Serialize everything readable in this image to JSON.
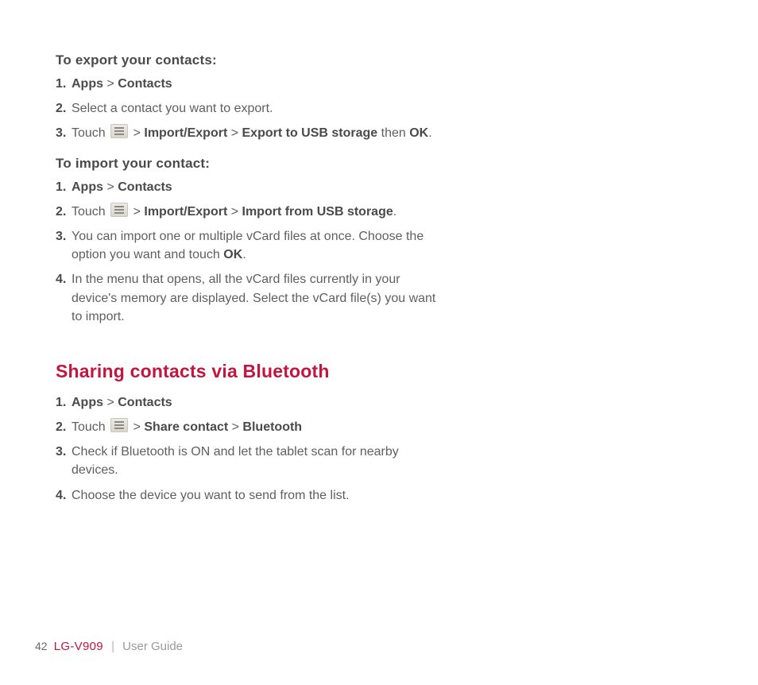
{
  "export": {
    "heading": "To export your contacts:",
    "step1": {
      "apps": "Apps",
      "gt": ">",
      "contacts": "Contacts"
    },
    "step2": "Select a contact you want to export.",
    "step3": {
      "touch": "Touch ",
      "gt1": " > ",
      "ie": "Import/Export",
      "gt2": " > ",
      "dest": "Export to USB storage",
      "then": " then ",
      "ok": "OK",
      "period": "."
    }
  },
  "import": {
    "heading": "To import your contact:",
    "step1": {
      "apps": "Apps",
      "gt": ">",
      "contacts": "Contacts"
    },
    "step2": {
      "touch": "Touch ",
      "gt1": " > ",
      "ie": "Import/Export",
      "gt2": " > ",
      "dest": "Import from USB storage",
      "period": "."
    },
    "step3a": "You can import one or multiple vCard files at once. Choose the option you want and touch ",
    "step3ok": "OK",
    "step3b": ".",
    "step4": "In the menu that opens, all the vCard files currently in your device's memory are displayed. Select the vCard file(s) you want to import."
  },
  "sharing": {
    "heading": "Sharing contacts via Bluetooth",
    "step1": {
      "apps": "Apps",
      "gt": ">",
      "contacts": "Contacts"
    },
    "step2": {
      "touch": "Touch ",
      "gt1": " > ",
      "share": "Share contact",
      "gt2": " > ",
      "bt": "Bluetooth"
    },
    "step3": "Check if Bluetooth is ON and let the tablet scan for nearby devices.",
    "step4": "Choose the device you want to send from the list."
  },
  "footer": {
    "page": "42",
    "model": "LG-V909",
    "divider": "|",
    "title": "User Guide"
  }
}
